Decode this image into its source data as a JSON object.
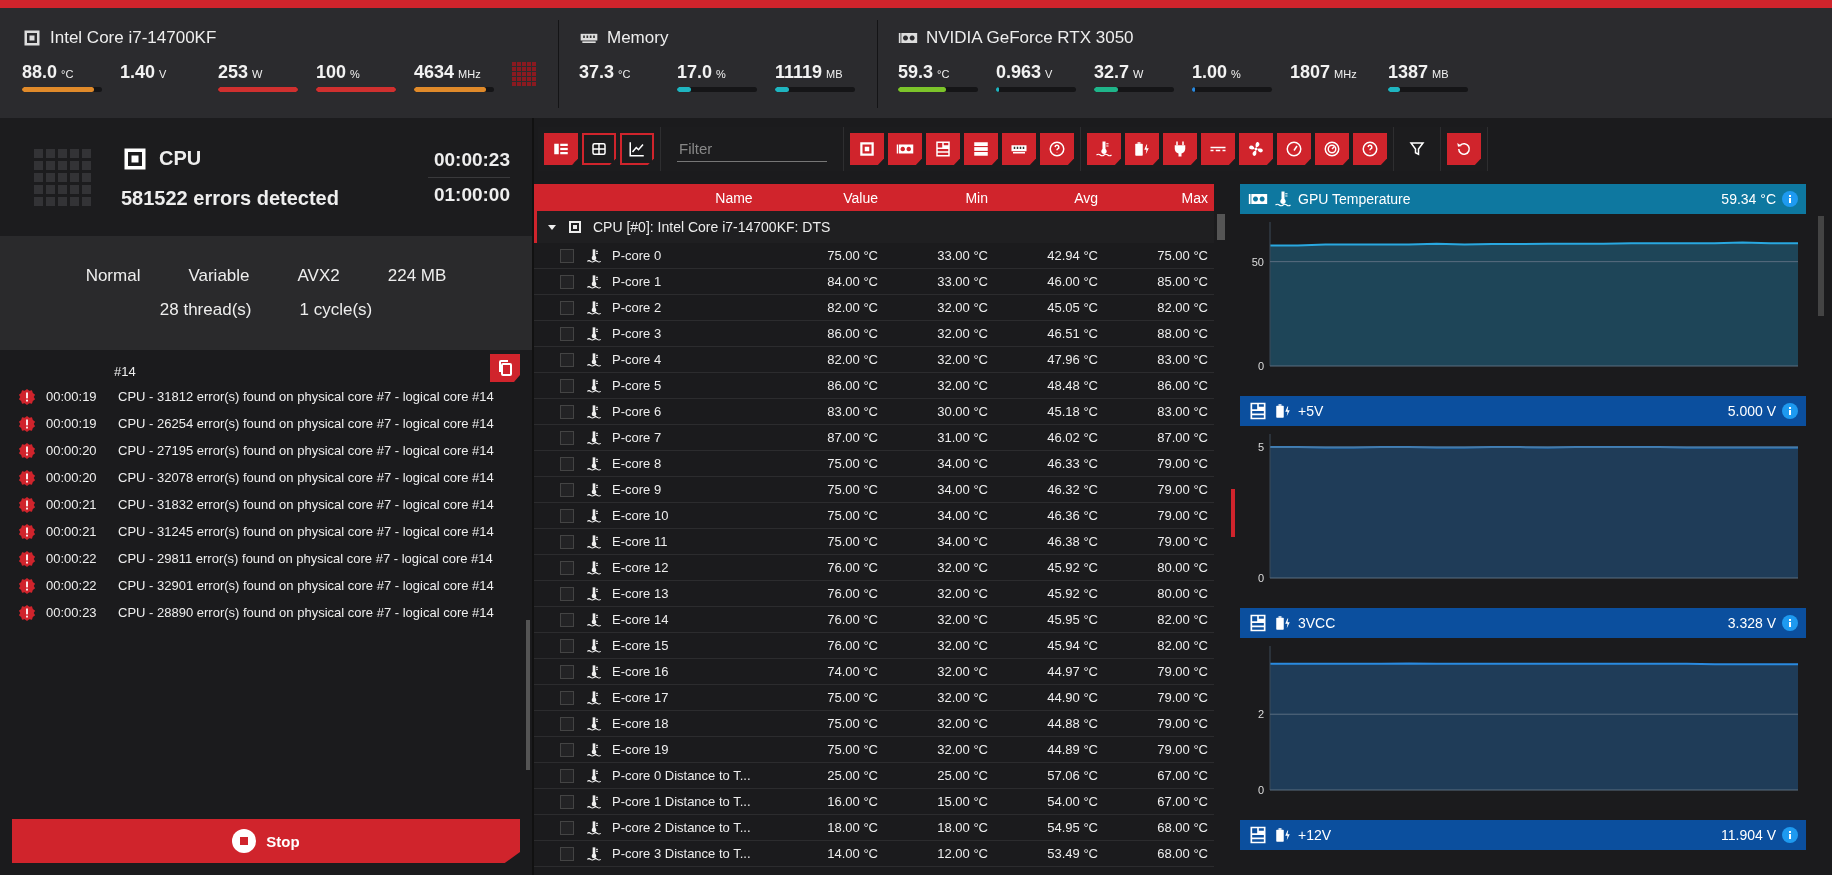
{
  "hardware": [
    {
      "kind": "cpu",
      "title": "Intel Core i7-14700KF",
      "metrics": [
        {
          "value": "88.0",
          "unit": "°C",
          "level": 0.9,
          "color": "#e08a2a"
        },
        {
          "value": "1.40",
          "unit": "V"
        },
        {
          "value": "253",
          "unit": "W",
          "level": 1,
          "color": "#d0302f"
        },
        {
          "value": "100",
          "unit": "%",
          "level": 1,
          "color": "#d0302f"
        },
        {
          "value": "4634",
          "unit": "MHz",
          "level": 0.9,
          "color": "#e08a2a"
        }
      ]
    },
    {
      "kind": "memory",
      "title": "Memory",
      "metrics": [
        {
          "value": "37.3",
          "unit": "°C"
        },
        {
          "value": "17.0",
          "unit": "%",
          "level": 0.17,
          "color": "#1fb5c0"
        },
        {
          "value": "11119",
          "unit": "MB",
          "level": 0.17,
          "color": "#1fb5c0"
        }
      ]
    },
    {
      "kind": "gpu",
      "title": "NVIDIA GeForce RTX 3050",
      "metrics": [
        {
          "value": "59.3",
          "unit": "°C",
          "level": 0.6,
          "color": "#7cc42a"
        },
        {
          "value": "0.963",
          "unit": "V",
          "level": 0.02,
          "color": "#1fb5c0"
        },
        {
          "value": "32.7",
          "unit": "W",
          "level": 0.3,
          "color": "#1fb58a"
        },
        {
          "value": "1.00",
          "unit": "%",
          "level": 0.01,
          "color": "#2a8ae0"
        },
        {
          "value": "1807",
          "unit": "MHz"
        },
        {
          "value": "1387",
          "unit": "MB",
          "level": 0.15,
          "color": "#1fb5c0"
        }
      ]
    }
  ],
  "test": {
    "device": "CPU",
    "errors": "581522 errors detected",
    "elapsed": "00:00:23",
    "duration": "01:00:00",
    "settings": [
      "Normal",
      "Variable",
      "AVX2",
      "224 MB"
    ],
    "settings_2": [
      "28 thread(s)",
      "1 cycle(s)"
    ]
  },
  "log": {
    "fragment": "#14",
    "entries": [
      {
        "time": "00:00:19",
        "message": "CPU - 31812 error(s) found on physical core #7 - logical core #14"
      },
      {
        "time": "00:00:19",
        "message": "CPU - 26254 error(s) found on physical core #7 - logical core #14"
      },
      {
        "time": "00:00:20",
        "message": "CPU - 27195 error(s) found on physical core #7 - logical core #14"
      },
      {
        "time": "00:00:20",
        "message": "CPU - 32078 error(s) found on physical core #7 - logical core #14"
      },
      {
        "time": "00:00:21",
        "message": "CPU - 31832 error(s) found on physical core #7 - logical core #14"
      },
      {
        "time": "00:00:21",
        "message": "CPU - 31245 error(s) found on physical core #7 - logical core #14"
      },
      {
        "time": "00:00:22",
        "message": "CPU - 29811 error(s) found on physical core #7 - logical core #14"
      },
      {
        "time": "00:00:22",
        "message": "CPU - 32901 error(s) found on physical core #7 - logical core #14"
      },
      {
        "time": "00:00:23",
        "message": "CPU - 28890 error(s) found on physical core #7 - logical core #14"
      }
    ]
  },
  "stop_button": "Stop",
  "toolbar": {
    "views": [
      {
        "kind": "list",
        "selected": true
      },
      {
        "kind": "table",
        "selected": false
      },
      {
        "kind": "graph",
        "selected": false
      }
    ],
    "filter": {
      "placeholder": "Filter"
    },
    "hardware_filters": [
      {
        "kind": "cpu"
      },
      {
        "kind": "gpu"
      },
      {
        "kind": "motherboard"
      },
      {
        "kind": "drive"
      },
      {
        "kind": "memory"
      },
      {
        "kind": "unknown"
      }
    ],
    "sensor_filters": [
      {
        "kind": "temperature"
      },
      {
        "kind": "voltage"
      },
      {
        "kind": "power"
      },
      {
        "kind": "current"
      },
      {
        "kind": "fan"
      },
      {
        "kind": "clock"
      },
      {
        "kind": "usage"
      },
      {
        "kind": "unknown"
      }
    ]
  },
  "table": {
    "columns": [
      "Name",
      "Value",
      "Min",
      "Avg",
      "Max"
    ],
    "group": {
      "label": "CPU [#0]: Intel Core i7-14700KF: DTS",
      "expanded": true
    },
    "rows": [
      {
        "name": "P-core 0",
        "value": "75.00 °C",
        "min": "33.00 °C",
        "avg": "42.94 °C",
        "max": "75.00 °C",
        "checked": false
      },
      {
        "name": "P-core 1",
        "value": "84.00 °C",
        "min": "33.00 °C",
        "avg": "46.00 °C",
        "max": "85.00 °C",
        "checked": false
      },
      {
        "name": "P-core 2",
        "value": "82.00 °C",
        "min": "32.00 °C",
        "avg": "45.05 °C",
        "max": "82.00 °C",
        "checked": false
      },
      {
        "name": "P-core 3",
        "value": "86.00 °C",
        "min": "32.00 °C",
        "avg": "46.51 °C",
        "max": "88.00 °C",
        "checked": false
      },
      {
        "name": "P-core 4",
        "value": "82.00 °C",
        "min": "32.00 °C",
        "avg": "47.96 °C",
        "max": "83.00 °C",
        "checked": false
      },
      {
        "name": "P-core 5",
        "value": "86.00 °C",
        "min": "32.00 °C",
        "avg": "48.48 °C",
        "max": "86.00 °C",
        "checked": false
      },
      {
        "name": "P-core 6",
        "value": "83.00 °C",
        "min": "30.00 °C",
        "avg": "45.18 °C",
        "max": "83.00 °C",
        "checked": false
      },
      {
        "name": "P-core 7",
        "value": "87.00 °C",
        "min": "31.00 °C",
        "avg": "46.02 °C",
        "max": "87.00 °C",
        "checked": false
      },
      {
        "name": "E-core 8",
        "value": "75.00 °C",
        "min": "34.00 °C",
        "avg": "46.33 °C",
        "max": "79.00 °C",
        "checked": false
      },
      {
        "name": "E-core 9",
        "value": "75.00 °C",
        "min": "34.00 °C",
        "avg": "46.32 °C",
        "max": "79.00 °C",
        "checked": false
      },
      {
        "name": "E-core 10",
        "value": "75.00 °C",
        "min": "34.00 °C",
        "avg": "46.36 °C",
        "max": "79.00 °C",
        "checked": false
      },
      {
        "name": "E-core 11",
        "value": "75.00 °C",
        "min": "34.00 °C",
        "avg": "46.38 °C",
        "max": "79.00 °C",
        "checked": false
      },
      {
        "name": "E-core 12",
        "value": "76.00 °C",
        "min": "32.00 °C",
        "avg": "45.92 °C",
        "max": "80.00 °C",
        "checked": false
      },
      {
        "name": "E-core 13",
        "value": "76.00 °C",
        "min": "32.00 °C",
        "avg": "45.92 °C",
        "max": "80.00 °C",
        "checked": false
      },
      {
        "name": "E-core 14",
        "value": "76.00 °C",
        "min": "32.00 °C",
        "avg": "45.95 °C",
        "max": "82.00 °C",
        "checked": false
      },
      {
        "name": "E-core 15",
        "value": "76.00 °C",
        "min": "32.00 °C",
        "avg": "45.94 °C",
        "max": "82.00 °C",
        "checked": false
      },
      {
        "name": "E-core 16",
        "value": "74.00 °C",
        "min": "32.00 °C",
        "avg": "44.97 °C",
        "max": "79.00 °C",
        "checked": false
      },
      {
        "name": "E-core 17",
        "value": "75.00 °C",
        "min": "32.00 °C",
        "avg": "44.90 °C",
        "max": "79.00 °C",
        "checked": false
      },
      {
        "name": "E-core 18",
        "value": "75.00 °C",
        "min": "32.00 °C",
        "avg": "44.88 °C",
        "max": "79.00 °C",
        "checked": false
      },
      {
        "name": "E-core 19",
        "value": "75.00 °C",
        "min": "32.00 °C",
        "avg": "44.89 °C",
        "max": "79.00 °C",
        "checked": false
      },
      {
        "name": "P-core 0 Distance to T...",
        "value": "25.00 °C",
        "min": "25.00 °C",
        "avg": "57.06 °C",
        "max": "67.00 °C",
        "checked": false
      },
      {
        "name": "P-core 1 Distance to T...",
        "value": "16.00 °C",
        "min": "15.00 °C",
        "avg": "54.00 °C",
        "max": "67.00 °C",
        "checked": false
      },
      {
        "name": "P-core 2 Distance to T...",
        "value": "18.00 °C",
        "min": "18.00 °C",
        "avg": "54.95 °C",
        "max": "68.00 °C",
        "checked": false
      },
      {
        "name": "P-core 3 Distance to T...",
        "value": "14.00 °C",
        "min": "12.00 °C",
        "avg": "53.49 °C",
        "max": "68.00 °C",
        "checked": false
      }
    ]
  },
  "charts": [
    {
      "title": "GPU Temperature",
      "reading": "59.34 °C",
      "kind": "temperature",
      "chart_data": {
        "type": "area",
        "ylim": [
          0,
          69
        ],
        "yticks": [
          0,
          50
        ],
        "series": [
          {
            "color": "#29a8e0",
            "values": [
              57.8,
              57.8,
              58.2,
              58.2,
              58.2,
              58.2,
              58.6,
              58.2,
              58.4,
              58.4,
              58.6,
              58.6,
              58.6,
              58.8,
              58.8,
              58.8,
              58.8,
              59.2,
              58.8,
              58.8
            ]
          }
        ]
      }
    },
    {
      "title": "+5V",
      "reading": "5.000 V",
      "kind": "voltage",
      "chart_data": {
        "type": "area",
        "ylim": [
          0,
          5.5
        ],
        "yticks": [
          0,
          5
        ],
        "series": [
          {
            "color": "#2a8ae0",
            "values": [
              5.0,
              5.0,
              4.99,
              4.99,
              5.0,
              5.0,
              4.99,
              4.99,
              5.0,
              5.0,
              4.99,
              5.0,
              5.0,
              5.0,
              5.0,
              4.99,
              4.99,
              4.99,
              4.99,
              4.99
            ]
          }
        ]
      }
    },
    {
      "title": "3VCC",
      "reading": "3.328 V",
      "kind": "voltage",
      "chart_data": {
        "type": "area",
        "ylim": [
          0,
          3.8
        ],
        "yticks": [
          0,
          2
        ],
        "series": [
          {
            "color": "#2a8ae0",
            "values": [
              3.33,
              3.33,
              3.33,
              3.33,
              3.33,
              3.34,
              3.33,
              3.33,
              3.33,
              3.33,
              3.33,
              3.33,
              3.33,
              3.33,
              3.33,
              3.33,
              3.32,
              3.32,
              3.32,
              3.32
            ]
          }
        ]
      }
    },
    {
      "title": "+12V",
      "reading": "11.904 V",
      "kind": "voltage"
    }
  ]
}
